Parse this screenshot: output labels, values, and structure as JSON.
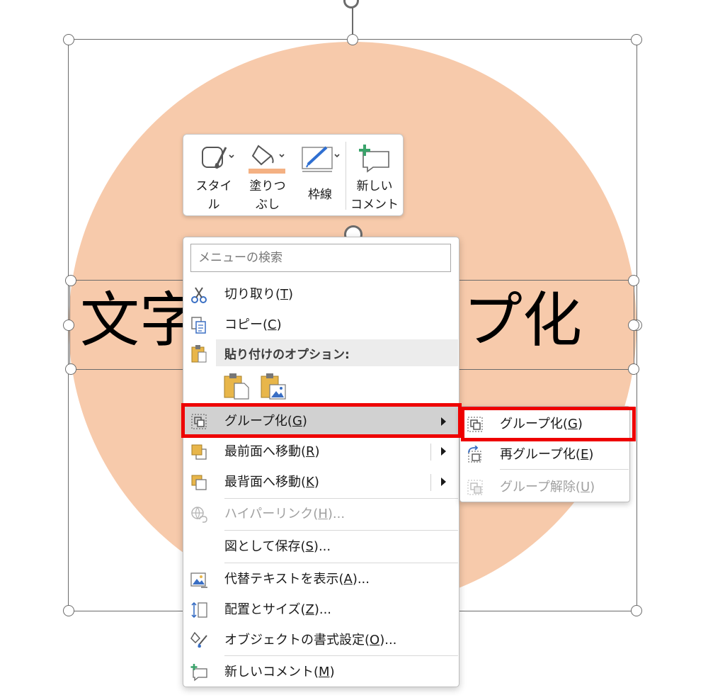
{
  "canvas": {
    "text_left": "文字",
    "text_right": "プ化",
    "shape_color": "#f7caab"
  },
  "mini_toolbar": {
    "style_label": "スタイ\nル",
    "fill_label": "塗りつ\nぶし",
    "outline_label": "枠線",
    "comment_label": "新しい\nコメント",
    "fill_accent": "#f4b183",
    "outline_accent": "#2f6fd1"
  },
  "context_menu": {
    "search_placeholder": "メニューの検索",
    "cut": {
      "text": "切り取り(",
      "key": "T",
      "suffix": ")"
    },
    "copy": {
      "text": "コピー(",
      "key": "C",
      "suffix": ")"
    },
    "paste_options": "貼り付けのオプション:",
    "group": {
      "text": "グループ化(",
      "key": "G",
      "suffix": ")"
    },
    "bring_front": {
      "text": "最前面へ移動(",
      "key": "R",
      "suffix": ")"
    },
    "send_back": {
      "text": "最背面へ移動(",
      "key": "K",
      "suffix": ")"
    },
    "hyperlink": {
      "text": "ハイパーリンク(",
      "key": "H",
      "suffix": ")..."
    },
    "save_as_picture": {
      "text": "図として保存(",
      "key": "S",
      "suffix": ")..."
    },
    "alt_text": {
      "text": "代替テキストを表示(",
      "key": "A",
      "suffix": ")..."
    },
    "size_position": {
      "text": "配置とサイズ(",
      "key": "Z",
      "suffix": ")..."
    },
    "format_object": {
      "text": "オブジェクトの書式設定(",
      "key": "O",
      "suffix": ")..."
    },
    "new_comment": {
      "text": "新しいコメント(",
      "key": "M",
      "suffix": ")"
    }
  },
  "submenu": {
    "group": {
      "text": "グループ化(",
      "key": "G",
      "suffix": ")"
    },
    "regroup": {
      "text": "再グループ化(",
      "key": "E",
      "suffix": ")"
    },
    "ungroup": {
      "text": "グループ解除(",
      "key": "U",
      "suffix": ")"
    }
  },
  "colors": {
    "highlight_red": "#ee0000",
    "hover_gray": "#d1d1d1",
    "icon_blue": "#3a6fc4",
    "icon_yellow": "#e8b64a"
  }
}
